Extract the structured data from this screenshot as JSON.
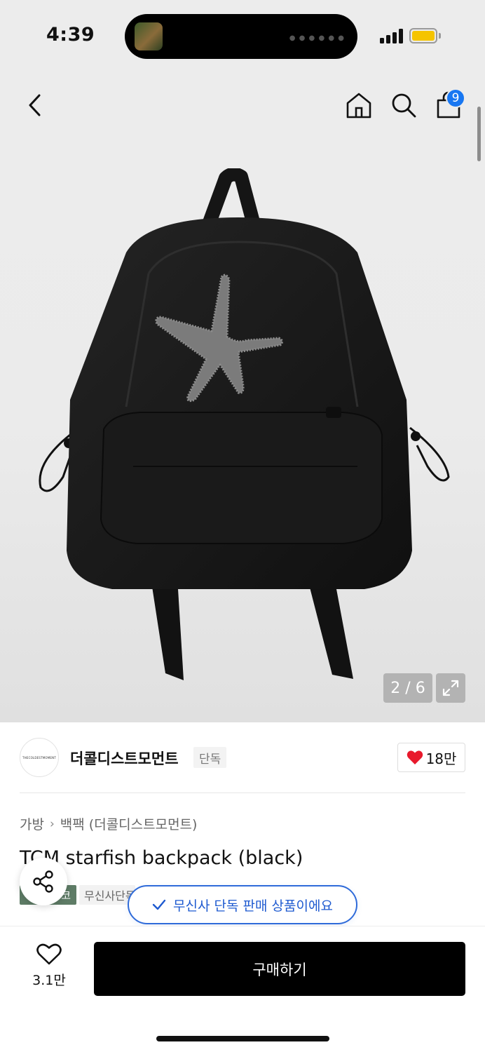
{
  "status_bar": {
    "time": "4:39",
    "signal_icon": "cellular-signal-icon",
    "battery_icon": "battery-icon",
    "battery_color": "#f5c400"
  },
  "header": {
    "back_icon": "chevron-left-icon",
    "home_icon": "home-icon",
    "search_icon": "search-icon",
    "cart_icon": "shopping-bag-icon",
    "cart_badge": "9",
    "badge_color": "#1877f2"
  },
  "gallery": {
    "counter": "2 / 6",
    "expand_icon": "expand-icon",
    "image_alt": "backpack-with-starfish-patch"
  },
  "brand": {
    "logo_text": "THECOLDESTMOMENT",
    "name": "더콜디스트모먼트",
    "tag": "단독",
    "likes": "18만",
    "heart_color": "#e8192c"
  },
  "product": {
    "breadcrumb": [
      "가방",
      "백팩 (더콜디스트모먼트)"
    ],
    "title": "TCM starfish backpack (black)",
    "tag_green": "코",
    "tag_grey": "무신사단독",
    "green_color": "#5e7c66"
  },
  "toast": {
    "text": "무신사 단독 판매 상품이에요",
    "accent": "#1e5ad0"
  },
  "bottom_bar": {
    "wish_count": "3.1만",
    "buy_label": "구매하기"
  }
}
